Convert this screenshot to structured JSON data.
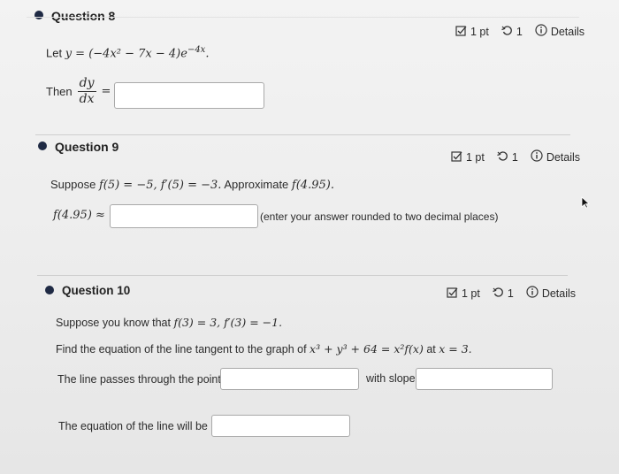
{
  "questions": [
    {
      "title": "Question 8",
      "points": "1 pt",
      "retries": "1",
      "details": "Details",
      "statement_prefix": "Let",
      "statement_math": "y = (−4x² − 7x − 4)e",
      "exponent": "−4x",
      "then_label": "Then",
      "frac_num": "dy",
      "frac_den": "dx",
      "equals": "="
    },
    {
      "title": "Question 9",
      "points": "1 pt",
      "retries": "1",
      "details": "Details",
      "statement_prefix": "Suppose",
      "statement_math_1": "f(5) = −5, f′(5) = −3.",
      "statement_mid": "Approximate",
      "statement_math_2": "f(4.95).",
      "answer_label": "f(4.95) ≈",
      "hint": "(enter your answer rounded to two decimal places)"
    },
    {
      "title": "Question 10",
      "points": "1 pt",
      "retries": "1",
      "details": "Details",
      "line1_prefix": "Suppose you know that",
      "line1_math": "f(3) = 3, f′(3) = −1.",
      "line2_prefix": "Find the equation of the line tangent to the graph of",
      "line2_math": "x³ + y³ + 64 = x²f(x)",
      "line2_mid": "at",
      "line2_math2": "x = 3.",
      "point_label": "The line passes through the point",
      "slope_label": "with slope",
      "equation_label": "The equation of the line will be"
    }
  ]
}
